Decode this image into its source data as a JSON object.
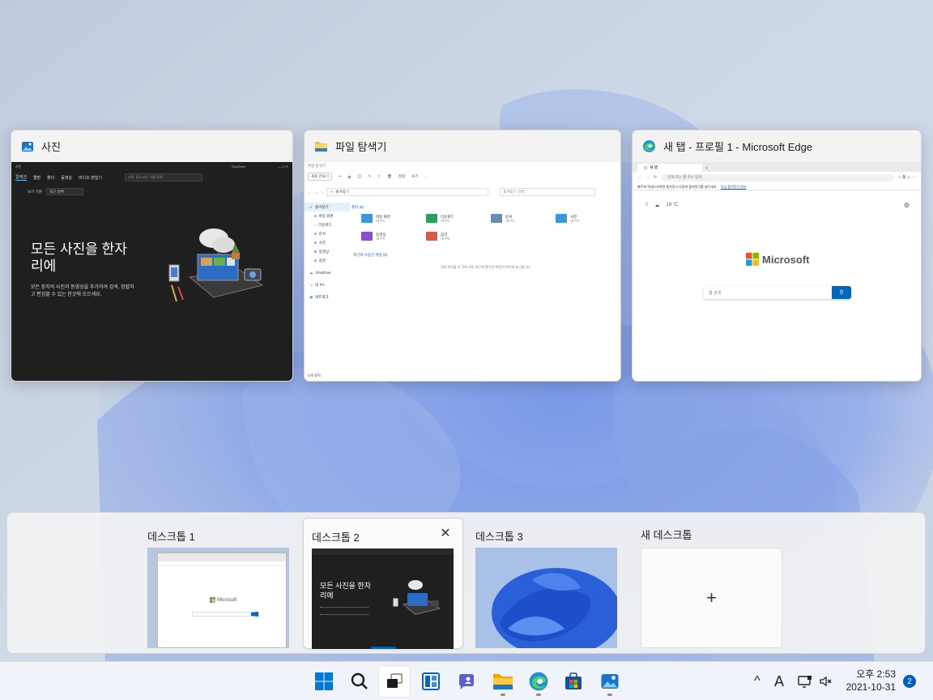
{
  "windows": [
    {
      "title": "사진",
      "app": "photos",
      "content": {
        "titlebar": "사진",
        "account": "OneDrive",
        "nav": [
          "컬렉션",
          "앨범",
          "폴더",
          "동영상",
          "비디오 편집기"
        ],
        "search_placeholder": "사람, 장소 또는 사물 검색...",
        "sort_label": "보기 기준:",
        "sort_value": "최근 날짜",
        "headline": "모든 사진을 한자리에",
        "description": "모든 장치의 사진과 동영상을 추가하여 검색, 정렬하고 편집할 수 있는 한곳에 모으세요."
      }
    },
    {
      "title": "파일 탐색기",
      "app": "explorer",
      "content": {
        "titlebar": "파일 탐색기",
        "new_button": "새로 만들기",
        "sort_button": "정렬",
        "view_button": "보기",
        "address": "즐겨찾기",
        "search_placeholder": "즐겨찾기 검색",
        "sidebar": [
          "즐겨찾기",
          "바탕 화면",
          "다운로드",
          "문서",
          "사진",
          "동영상",
          "음악",
          "OneDrive",
          "내 PC",
          "네트워크"
        ],
        "folders_heading": "폴더 (8)",
        "folders": [
          {
            "name": "바탕 화면",
            "sub": "내 PC",
            "color": "#3a96dd"
          },
          {
            "name": "다운로드",
            "sub": "내 PC",
            "color": "#2aa05a"
          },
          {
            "name": "문서",
            "sub": "내 PC",
            "color": "#6a8caf"
          },
          {
            "name": "사진",
            "sub": "내 PC",
            "color": "#3a96dd"
          },
          {
            "name": "동영상",
            "sub": "내 PC",
            "color": "#8a4fd1"
          },
          {
            "name": "음악",
            "sub": "내 PC",
            "color": "#d65a4a"
          }
        ],
        "recent_heading": "최근에 사용한 파일 (0)",
        "recent_empty": "일부 파일을 연 후에 가장 최근에 열어 본 파일이 여기에 표시됩니다.",
        "status": "6개 항목"
      }
    },
    {
      "title": "새 탭 - 프로필 1 - Microsoft Edge",
      "app": "edge",
      "content": {
        "tab": "새 탭",
        "address_placeholder": "검색 또는 웹 주소 입력",
        "info_bar": "빠르게 액세스하려면 즐겨찾기 모음에 즐겨찾기를 넣으세요.",
        "info_link": "지금 즐겨찾기 관리",
        "weather": "19 °C",
        "brand": "Microsoft",
        "search_placeholder": "웹 검색"
      }
    }
  ],
  "desktops": [
    {
      "label": "데스크톱 1",
      "active": false,
      "preview": "edge"
    },
    {
      "label": "데스크톱 2",
      "active": true,
      "preview": "photos"
    },
    {
      "label": "데스크톱 3",
      "active": false,
      "preview": "wallpaper"
    },
    {
      "label": "새 데스크톱",
      "active": false,
      "preview": "new",
      "plus": "+"
    }
  ],
  "taskbar": {
    "apps": [
      {
        "name": "start-button",
        "icon": "windows-logo-icon",
        "pressed": false,
        "running": false
      },
      {
        "name": "search-button",
        "icon": "search-icon",
        "pressed": false,
        "running": false
      },
      {
        "name": "task-view-button",
        "icon": "task-view-icon",
        "pressed": true,
        "running": false
      },
      {
        "name": "widgets-button",
        "icon": "widgets-icon",
        "pressed": false,
        "running": false
      },
      {
        "name": "chat-button",
        "icon": "chat-icon",
        "pressed": false,
        "running": false
      },
      {
        "name": "file-explorer-button",
        "icon": "folder-icon",
        "pressed": false,
        "running": true
      },
      {
        "name": "edge-button",
        "icon": "edge-icon",
        "pressed": false,
        "running": true
      },
      {
        "name": "store-button",
        "icon": "store-icon",
        "pressed": false,
        "running": false
      },
      {
        "name": "photos-button",
        "icon": "photos-icon",
        "pressed": false,
        "running": true
      }
    ],
    "tray": {
      "chevron": "^",
      "ime": "A",
      "time_period": "오후 2:53",
      "date": "2021-10-31",
      "notifications": "2"
    }
  },
  "colors": {
    "accent": "#005fb8",
    "photos_bg": "#1f1f1f",
    "taskbar_bg": "#f0f3f9"
  }
}
